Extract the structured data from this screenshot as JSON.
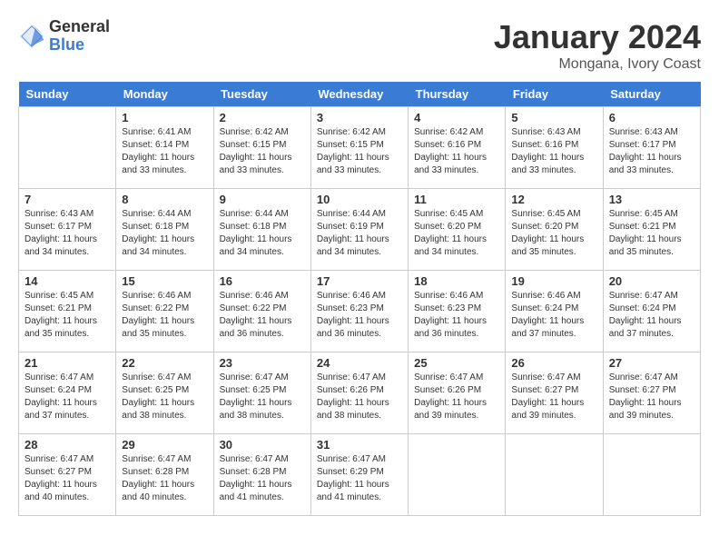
{
  "logo": {
    "general": "General",
    "blue": "Blue"
  },
  "title": "January 2024",
  "location": "Mongana, Ivory Coast",
  "days_of_week": [
    "Sunday",
    "Monday",
    "Tuesday",
    "Wednesday",
    "Thursday",
    "Friday",
    "Saturday"
  ],
  "weeks": [
    [
      {
        "day": "",
        "info": ""
      },
      {
        "day": "1",
        "info": "Sunrise: 6:41 AM\nSunset: 6:14 PM\nDaylight: 11 hours\nand 33 minutes."
      },
      {
        "day": "2",
        "info": "Sunrise: 6:42 AM\nSunset: 6:15 PM\nDaylight: 11 hours\nand 33 minutes."
      },
      {
        "day": "3",
        "info": "Sunrise: 6:42 AM\nSunset: 6:15 PM\nDaylight: 11 hours\nand 33 minutes."
      },
      {
        "day": "4",
        "info": "Sunrise: 6:42 AM\nSunset: 6:16 PM\nDaylight: 11 hours\nand 33 minutes."
      },
      {
        "day": "5",
        "info": "Sunrise: 6:43 AM\nSunset: 6:16 PM\nDaylight: 11 hours\nand 33 minutes."
      },
      {
        "day": "6",
        "info": "Sunrise: 6:43 AM\nSunset: 6:17 PM\nDaylight: 11 hours\nand 33 minutes."
      }
    ],
    [
      {
        "day": "7",
        "info": "Sunrise: 6:43 AM\nSunset: 6:17 PM\nDaylight: 11 hours\nand 34 minutes."
      },
      {
        "day": "8",
        "info": "Sunrise: 6:44 AM\nSunset: 6:18 PM\nDaylight: 11 hours\nand 34 minutes."
      },
      {
        "day": "9",
        "info": "Sunrise: 6:44 AM\nSunset: 6:18 PM\nDaylight: 11 hours\nand 34 minutes."
      },
      {
        "day": "10",
        "info": "Sunrise: 6:44 AM\nSunset: 6:19 PM\nDaylight: 11 hours\nand 34 minutes."
      },
      {
        "day": "11",
        "info": "Sunrise: 6:45 AM\nSunset: 6:20 PM\nDaylight: 11 hours\nand 34 minutes."
      },
      {
        "day": "12",
        "info": "Sunrise: 6:45 AM\nSunset: 6:20 PM\nDaylight: 11 hours\nand 35 minutes."
      },
      {
        "day": "13",
        "info": "Sunrise: 6:45 AM\nSunset: 6:21 PM\nDaylight: 11 hours\nand 35 minutes."
      }
    ],
    [
      {
        "day": "14",
        "info": "Sunrise: 6:45 AM\nSunset: 6:21 PM\nDaylight: 11 hours\nand 35 minutes."
      },
      {
        "day": "15",
        "info": "Sunrise: 6:46 AM\nSunset: 6:22 PM\nDaylight: 11 hours\nand 35 minutes."
      },
      {
        "day": "16",
        "info": "Sunrise: 6:46 AM\nSunset: 6:22 PM\nDaylight: 11 hours\nand 36 minutes."
      },
      {
        "day": "17",
        "info": "Sunrise: 6:46 AM\nSunset: 6:23 PM\nDaylight: 11 hours\nand 36 minutes."
      },
      {
        "day": "18",
        "info": "Sunrise: 6:46 AM\nSunset: 6:23 PM\nDaylight: 11 hours\nand 36 minutes."
      },
      {
        "day": "19",
        "info": "Sunrise: 6:46 AM\nSunset: 6:24 PM\nDaylight: 11 hours\nand 37 minutes."
      },
      {
        "day": "20",
        "info": "Sunrise: 6:47 AM\nSunset: 6:24 PM\nDaylight: 11 hours\nand 37 minutes."
      }
    ],
    [
      {
        "day": "21",
        "info": "Sunrise: 6:47 AM\nSunset: 6:24 PM\nDaylight: 11 hours\nand 37 minutes."
      },
      {
        "day": "22",
        "info": "Sunrise: 6:47 AM\nSunset: 6:25 PM\nDaylight: 11 hours\nand 38 minutes."
      },
      {
        "day": "23",
        "info": "Sunrise: 6:47 AM\nSunset: 6:25 PM\nDaylight: 11 hours\nand 38 minutes."
      },
      {
        "day": "24",
        "info": "Sunrise: 6:47 AM\nSunset: 6:26 PM\nDaylight: 11 hours\nand 38 minutes."
      },
      {
        "day": "25",
        "info": "Sunrise: 6:47 AM\nSunset: 6:26 PM\nDaylight: 11 hours\nand 39 minutes."
      },
      {
        "day": "26",
        "info": "Sunrise: 6:47 AM\nSunset: 6:27 PM\nDaylight: 11 hours\nand 39 minutes."
      },
      {
        "day": "27",
        "info": "Sunrise: 6:47 AM\nSunset: 6:27 PM\nDaylight: 11 hours\nand 39 minutes."
      }
    ],
    [
      {
        "day": "28",
        "info": "Sunrise: 6:47 AM\nSunset: 6:27 PM\nDaylight: 11 hours\nand 40 minutes."
      },
      {
        "day": "29",
        "info": "Sunrise: 6:47 AM\nSunset: 6:28 PM\nDaylight: 11 hours\nand 40 minutes."
      },
      {
        "day": "30",
        "info": "Sunrise: 6:47 AM\nSunset: 6:28 PM\nDaylight: 11 hours\nand 41 minutes."
      },
      {
        "day": "31",
        "info": "Sunrise: 6:47 AM\nSunset: 6:29 PM\nDaylight: 11 hours\nand 41 minutes."
      },
      {
        "day": "",
        "info": ""
      },
      {
        "day": "",
        "info": ""
      },
      {
        "day": "",
        "info": ""
      }
    ]
  ]
}
